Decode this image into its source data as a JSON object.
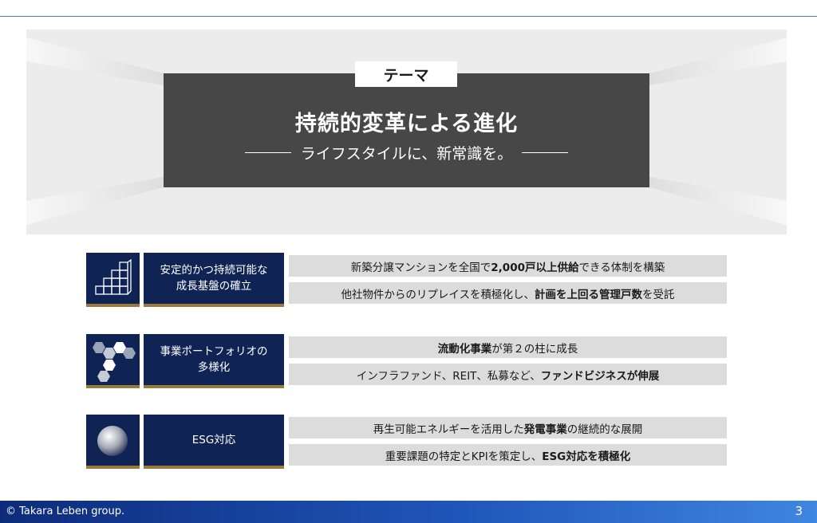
{
  "theme": {
    "tag": "テーマ",
    "title": "持続的変革による進化",
    "subtitle": "ライフスタイルに、新常識を。"
  },
  "rows": [
    {
      "icon": "cubes-icon",
      "label_line1": "安定的かつ持続可能な",
      "label_line2": "成長基盤の確立",
      "items": [
        {
          "pre": "新築分譲マンションを全国で",
          "bold": "2,000戸以上供給",
          "post": "できる体制を構築"
        },
        {
          "pre": "他社物件からのリプレイスを積極化し、",
          "bold": "計画を上回る管理戸数",
          "post": "を受託"
        }
      ]
    },
    {
      "icon": "hexagons-icon",
      "label_line1": "事業ポートフォリオの",
      "label_line2": "多様化",
      "items": [
        {
          "pre": "",
          "bold": "流動化事業",
          "post": "が第２の柱に成長"
        },
        {
          "pre": "インフラファンド、REIT、私募など、",
          "bold": "ファンドビジネスが伸展",
          "post": ""
        }
      ]
    },
    {
      "icon": "globe-icon",
      "label_line1": "ESG対応",
      "label_line2": "",
      "items": [
        {
          "pre": "再生可能エネルギーを活用した",
          "bold": "発電事業",
          "post": "の継続的な展開"
        },
        {
          "pre": "重要課題の特定とKPIを策定し、",
          "bold": "ESG対応を積極化",
          "post": ""
        }
      ]
    }
  ],
  "footer": {
    "copyright": "© Takara Leben group.",
    "page_number": "3"
  }
}
